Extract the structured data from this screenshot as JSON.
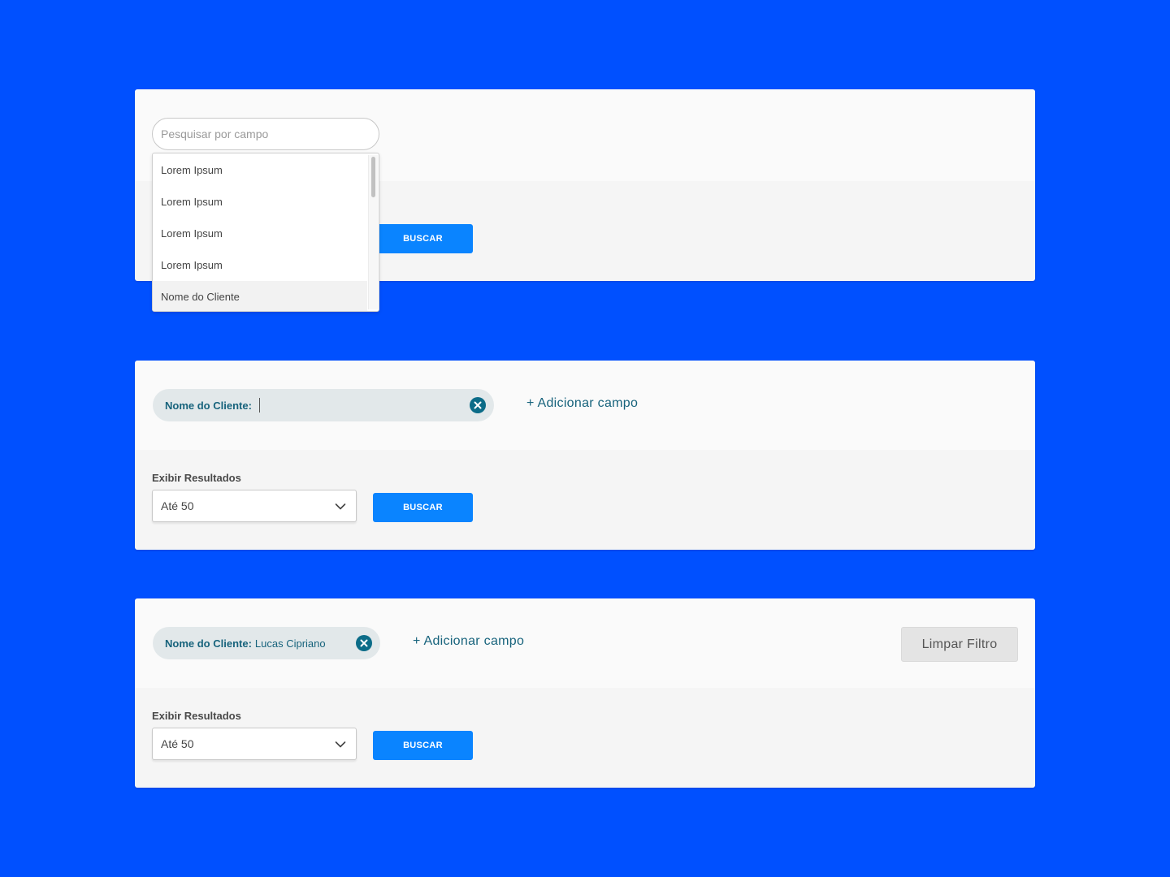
{
  "panel1": {
    "search": {
      "placeholder": "Pesquisar por campo",
      "value": ""
    },
    "dropdown_options": [
      "Lorem Ipsum",
      "Lorem Ipsum",
      "Lorem Ipsum",
      "Lorem Ipsum",
      "Nome do Cliente"
    ],
    "highlighted_option": "Nome do Cliente",
    "buscar_label": "BUSCAR"
  },
  "panel2": {
    "chip": {
      "label": "Nome do Cliente:",
      "value": ""
    },
    "add_field_label": "+ Adicionar campo",
    "results_label": "Exibir Resultados",
    "results_select_value": "Até 50",
    "buscar_label": "BUSCAR"
  },
  "panel3": {
    "chip": {
      "label": "Nome do Cliente:",
      "value": "Lucas Cipriano"
    },
    "add_field_label": "+ Adicionar campo",
    "clear_filter_label": "Limpar Filtro",
    "results_label": "Exibir Resultados",
    "results_select_value": "Até 50",
    "buscar_label": "BUSCAR"
  },
  "colors": {
    "background": "#0050ff",
    "primary_button": "#0a84ff",
    "chip_background": "#e2e8ea",
    "chip_text": "#17637c",
    "close_icon": "#0c6c88"
  },
  "icons": {
    "chip_close": "close-circle-icon",
    "select_chevron": "chevron-down-icon"
  }
}
